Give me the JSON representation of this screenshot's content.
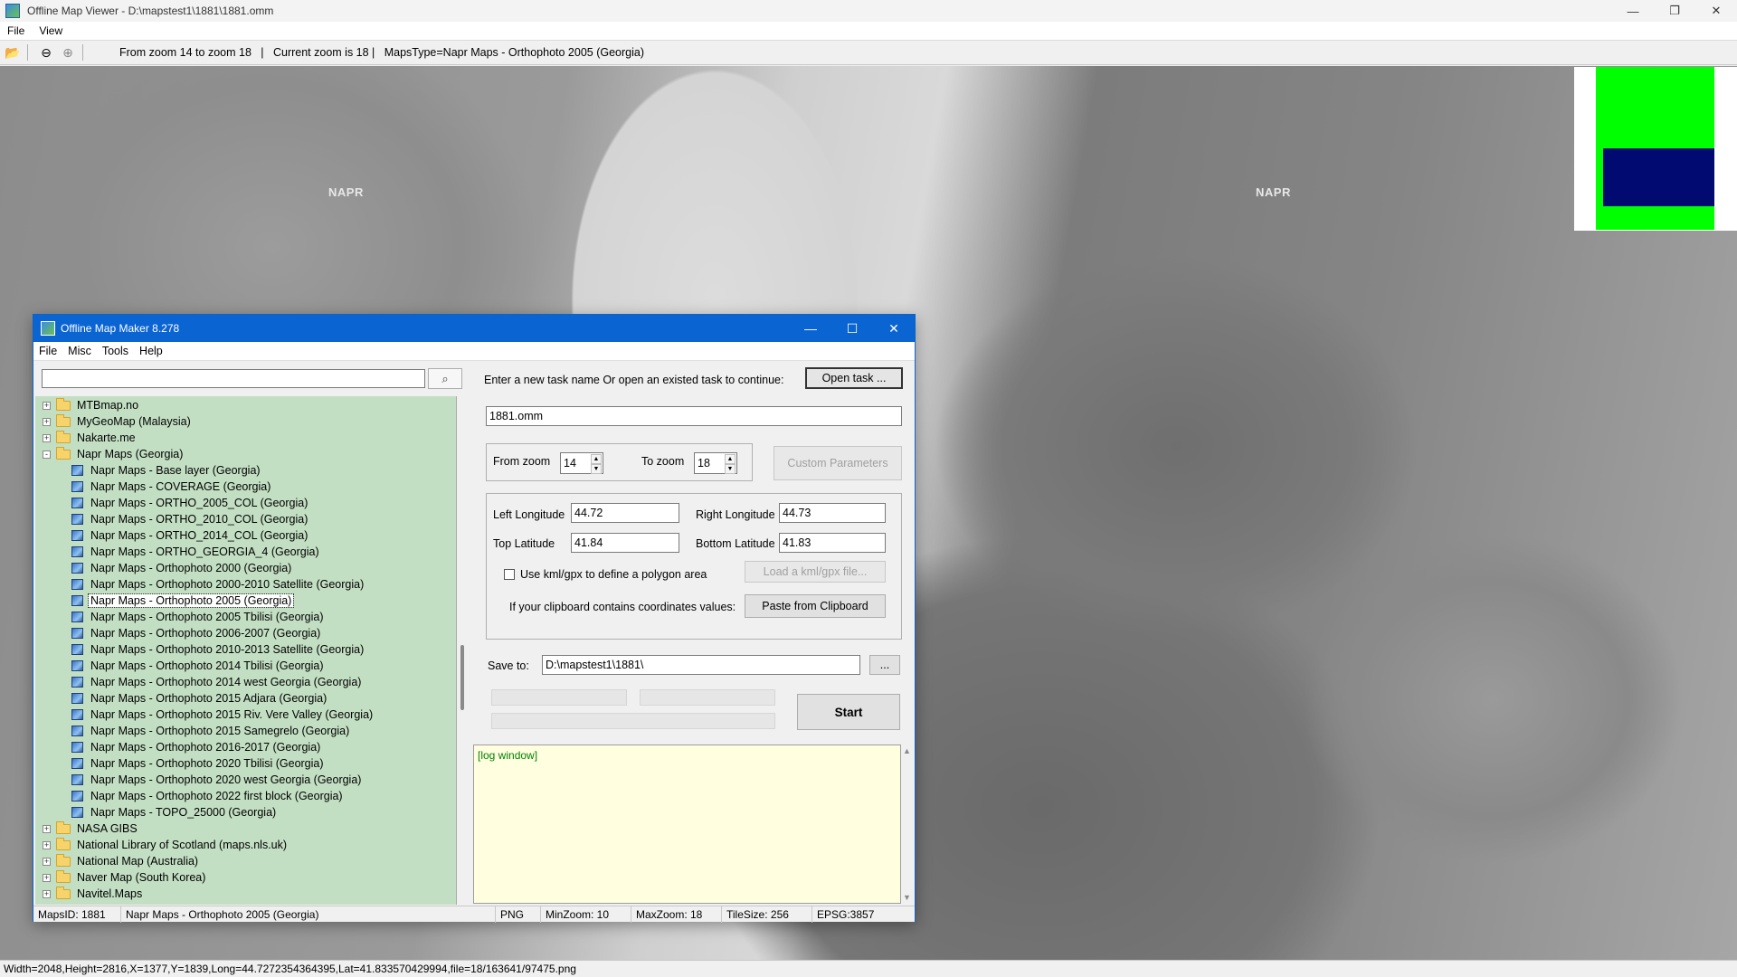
{
  "viewer": {
    "title": "Offline Map Viewer - D:\\mapstest1\\1881\\1881.omm",
    "menu": [
      "File",
      "View"
    ],
    "toolbar_status": "From zoom 14 to zoom 18   |   Current zoom is 18 |   MapsType=Napr Maps - Orthophoto 2005 (Georgia)",
    "map_labels": [
      "NAPR",
      "NAPR"
    ],
    "status_text": "Width=2048,Height=2816,X=1377,Y=1839,Long=44.7272354364395,Lat=41.833570429994,file=18/163641/97475.png",
    "minimap_colors": {
      "viewport": "#00ff00",
      "area": "#000a70"
    }
  },
  "dialog": {
    "title": "Offline Map Maker 8.278",
    "menu": [
      "File",
      "Misc",
      "Tools",
      "Help"
    ],
    "search_value": "",
    "tree": [
      {
        "label": "MTBmap.no",
        "kind": "folder",
        "expander": "+"
      },
      {
        "label": "MyGeoMap (Malaysia)",
        "kind": "folder",
        "expander": "+"
      },
      {
        "label": "Nakarte.me",
        "kind": "folder",
        "expander": "+"
      },
      {
        "label": "Napr Maps (Georgia)",
        "kind": "folder-open",
        "expander": "-"
      },
      {
        "label": "Napr Maps - Base layer (Georgia)",
        "kind": "map"
      },
      {
        "label": "Napr Maps - COVERAGE (Georgia)",
        "kind": "map"
      },
      {
        "label": "Napr Maps - ORTHO_2005_COL (Georgia)",
        "kind": "map"
      },
      {
        "label": "Napr Maps - ORTHO_2010_COL (Georgia)",
        "kind": "map"
      },
      {
        "label": "Napr Maps - ORTHO_2014_COL (Georgia)",
        "kind": "map"
      },
      {
        "label": "Napr Maps - ORTHO_GEORGIA_4 (Georgia)",
        "kind": "map"
      },
      {
        "label": "Napr Maps - Orthophoto 2000 (Georgia)",
        "kind": "map"
      },
      {
        "label": "Napr Maps - Orthophoto 2000-2010 Satellite (Georgia)",
        "kind": "map"
      },
      {
        "label": "Napr Maps - Orthophoto 2005 (Georgia)",
        "kind": "map",
        "selected": true
      },
      {
        "label": "Napr Maps - Orthophoto 2005 Tbilisi (Georgia)",
        "kind": "map"
      },
      {
        "label": "Napr Maps - Orthophoto 2006-2007 (Georgia)",
        "kind": "map"
      },
      {
        "label": "Napr Maps - Orthophoto 2010-2013 Satellite (Georgia)",
        "kind": "map"
      },
      {
        "label": "Napr Maps - Orthophoto 2014 Tbilisi (Georgia)",
        "kind": "map"
      },
      {
        "label": "Napr Maps - Orthophoto 2014 west Georgia (Georgia)",
        "kind": "map"
      },
      {
        "label": "Napr Maps - Orthophoto 2015 Adjara (Georgia)",
        "kind": "map"
      },
      {
        "label": "Napr Maps - Orthophoto 2015 Riv. Vere Valley (Georgia)",
        "kind": "map"
      },
      {
        "label": "Napr Maps - Orthophoto 2015 Samegrelo (Georgia)",
        "kind": "map"
      },
      {
        "label": "Napr Maps - Orthophoto 2016-2017 (Georgia)",
        "kind": "map"
      },
      {
        "label": "Napr Maps - Orthophoto 2020 Tbilisi (Georgia)",
        "kind": "map"
      },
      {
        "label": "Napr Maps - Orthophoto 2020 west Georgia (Georgia)",
        "kind": "map"
      },
      {
        "label": "Napr Maps - Orthophoto 2022 first block (Georgia)",
        "kind": "map"
      },
      {
        "label": "Napr Maps - TOPO_25000 (Georgia)",
        "kind": "map"
      },
      {
        "label": "NASA GIBS",
        "kind": "folder",
        "expander": "+"
      },
      {
        "label": "National Library of Scotland (maps.nls.uk)",
        "kind": "folder",
        "expander": "+"
      },
      {
        "label": "National Map (Australia)",
        "kind": "folder",
        "expander": "+"
      },
      {
        "label": "Naver Map (South Korea)",
        "kind": "folder",
        "expander": "+"
      },
      {
        "label": "Navitel.Maps",
        "kind": "folder",
        "expander": "+"
      }
    ],
    "task_prompt": "Enter a new task name Or open an existed task to continue:",
    "open_task_label": "Open task ...",
    "task_name": "1881.omm",
    "from_zoom_label": "From zoom",
    "from_zoom": "14",
    "to_zoom_label": "To zoom",
    "to_zoom": "18",
    "custom_params_label": "Custom Parameters",
    "left_lon_label": "Left Longitude",
    "left_lon": "44.72",
    "right_lon_label": "Right Longitude",
    "right_lon": "44.73",
    "top_lat_label": "Top Latitude",
    "top_lat": "41.84",
    "bottom_lat_label": "Bottom Latitude",
    "bottom_lat": "41.83",
    "kml_label": "Use kml/gpx to define a polygon area",
    "load_kml_label": "Load a kml/gpx file...",
    "clipboard_label": "If your clipboard contains coordinates values:",
    "paste_label": "Paste from Clipboard",
    "save_to_label": "Save to:",
    "save_path": "D:\\mapstest1\\1881\\",
    "browse_label": "...",
    "start_label": "Start",
    "log_text": "[log window]",
    "status": {
      "maps_id": "MapsID: 1881",
      "map_name": "Napr Maps - Orthophoto 2005 (Georgia)",
      "format": "PNG",
      "min_zoom": "MinZoom: 10",
      "max_zoom": "MaxZoom: 18",
      "tile_size": "TileSize: 256",
      "epsg": "EPSG:3857"
    }
  }
}
